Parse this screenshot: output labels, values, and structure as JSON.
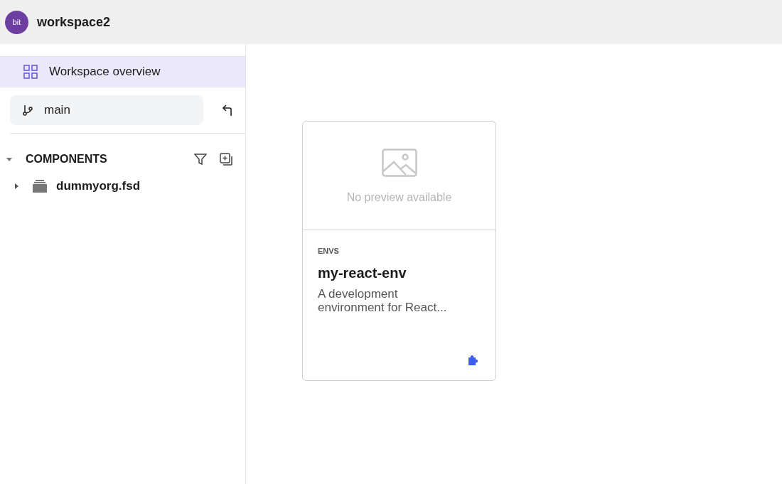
{
  "header": {
    "logo": "bit",
    "title": "workspace2"
  },
  "sidebar": {
    "nav": [
      {
        "label": "Workspace overview",
        "selected": true
      }
    ],
    "branch": {
      "value": "main"
    },
    "section": {
      "title": "COMPONENTS",
      "expanded": true
    },
    "tree": [
      {
        "label": "dummyorg.fsd",
        "expanded": false
      }
    ]
  },
  "cards": [
    {
      "preview": "No preview available",
      "namespace": "ENVS",
      "name": "my-react-env",
      "description": "A development",
      "description_2": "environment for React..."
    }
  ]
}
